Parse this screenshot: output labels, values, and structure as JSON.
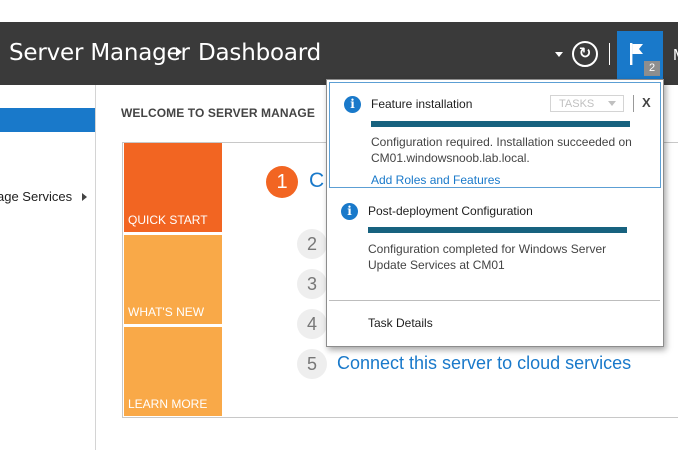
{
  "header": {
    "app_title": "Server Manager",
    "page": "Dashboard",
    "notification_count": "2",
    "overflow_text": "M",
    "refresh_icon": "refresh-icon",
    "flag_icon": "flag-icon"
  },
  "sidebar": {
    "items": [
      {
        "label": "age Services"
      }
    ]
  },
  "welcome": {
    "title": "WELCOME TO SERVER MANAGE"
  },
  "tiles": [
    {
      "label": "QUICK START",
      "color": "#f26522"
    },
    {
      "label": "WHAT'S NEW",
      "color": "#f9a948"
    },
    {
      "label": "LEARN MORE",
      "color": "#f9a948"
    }
  ],
  "steps": [
    {
      "number": "1",
      "text": "C"
    },
    {
      "number": "2"
    },
    {
      "number": "3"
    },
    {
      "number": "4"
    },
    {
      "number": "5",
      "text": "Connect this server to cloud services"
    }
  ],
  "notifications": [
    {
      "title": "Feature installation",
      "tasks_label": "TASKS",
      "close_label": "X",
      "progress": 1.0,
      "message": "Configuration required. Installation succeeded on CM01.windowsnoob.lab.local.",
      "link": "Add Roles and Features"
    },
    {
      "title": "Post-deployment Configuration",
      "progress": 1.0,
      "message": "Configuration completed for Windows Server Update Services at CM01"
    }
  ],
  "popup": {
    "task_details": "Task Details"
  },
  "colors": {
    "accent": "#1979ca",
    "header_bg": "#3a3a3a",
    "progress": "#17627f",
    "quick_start": "#f26522",
    "tile_secondary": "#f9a948"
  }
}
